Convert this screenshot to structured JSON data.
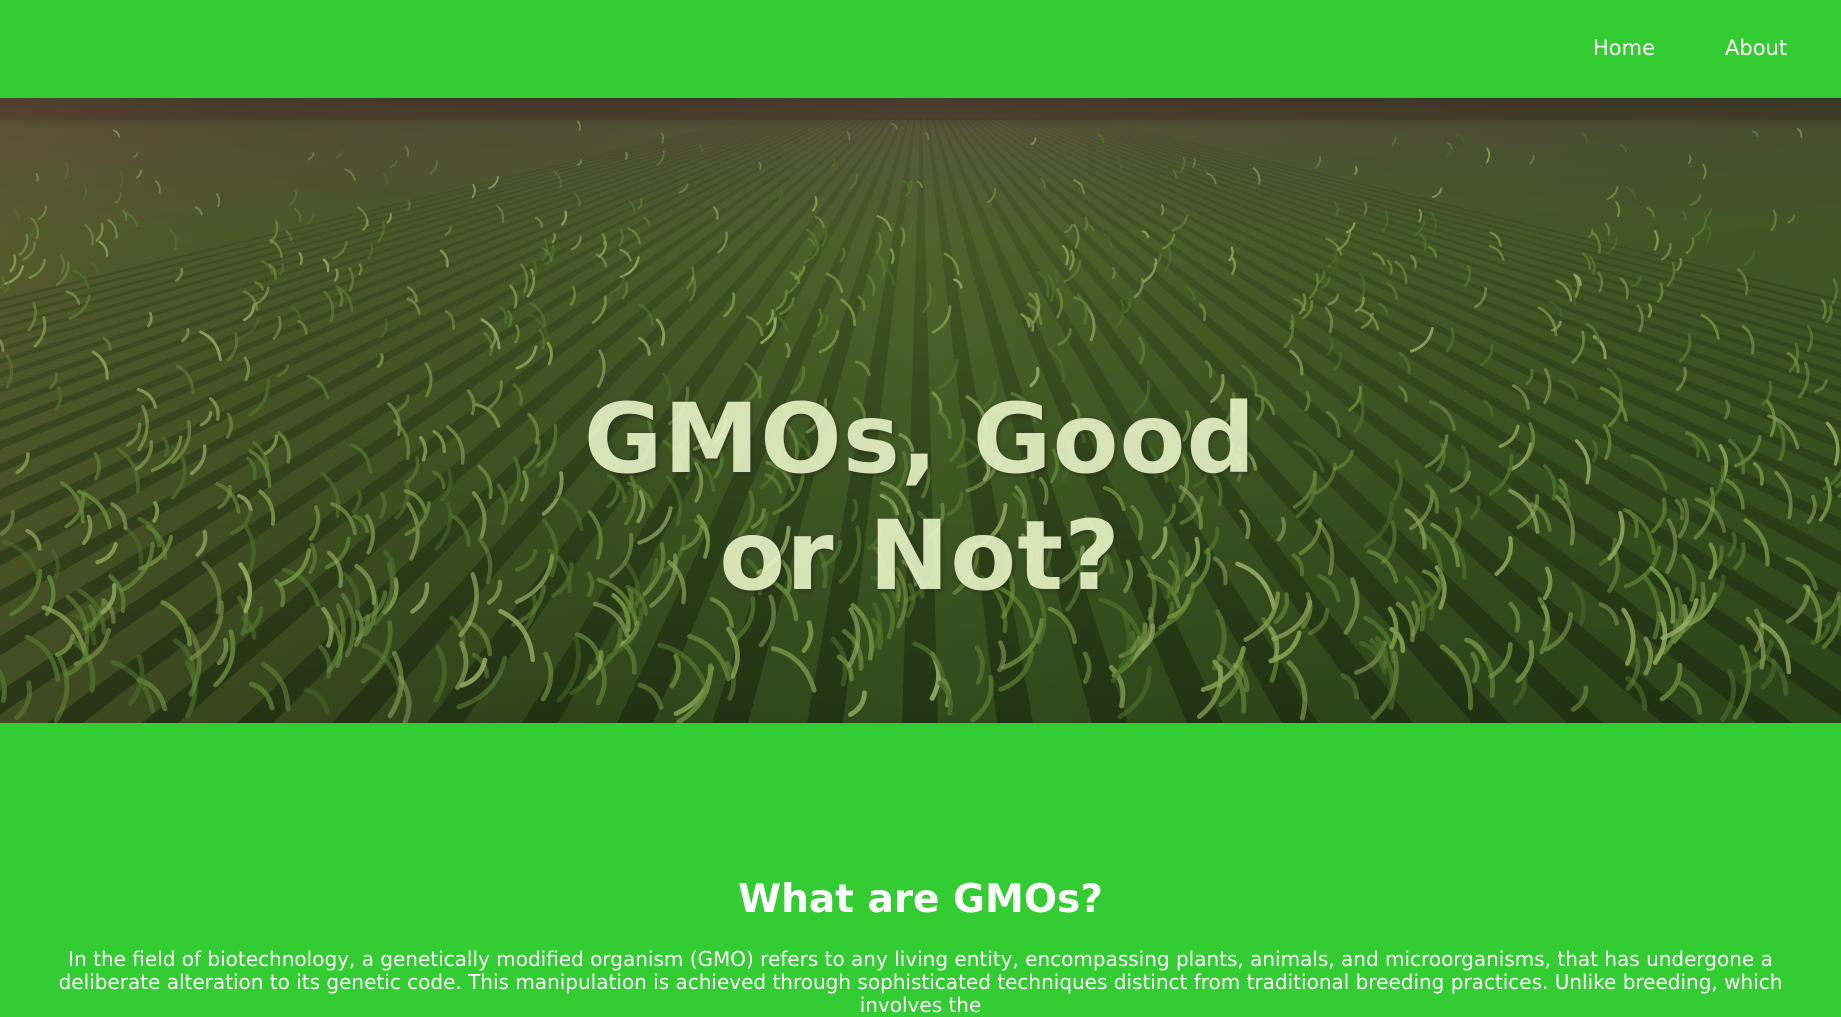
{
  "nav": {
    "home_label": "Home",
    "about_label": "About"
  },
  "hero": {
    "title": "GMOs, Good or Not?",
    "image_subject": "cornfield"
  },
  "section": {
    "heading": "What are GMOs?",
    "text": "In the field of biotechnology, a genetically modified organism (GMO) refers to any living entity, encompassing plants, animals, and microorganisms, that has undergone a deliberate alteration to its genetic code. This manipulation is achieved through sophisticated techniques distinct from traditional breeding practices. Unlike breeding, which involves the"
  },
  "colors": {
    "background": "#33cc33",
    "text": "#ffffff",
    "hero_title": "#e9f4c6"
  }
}
